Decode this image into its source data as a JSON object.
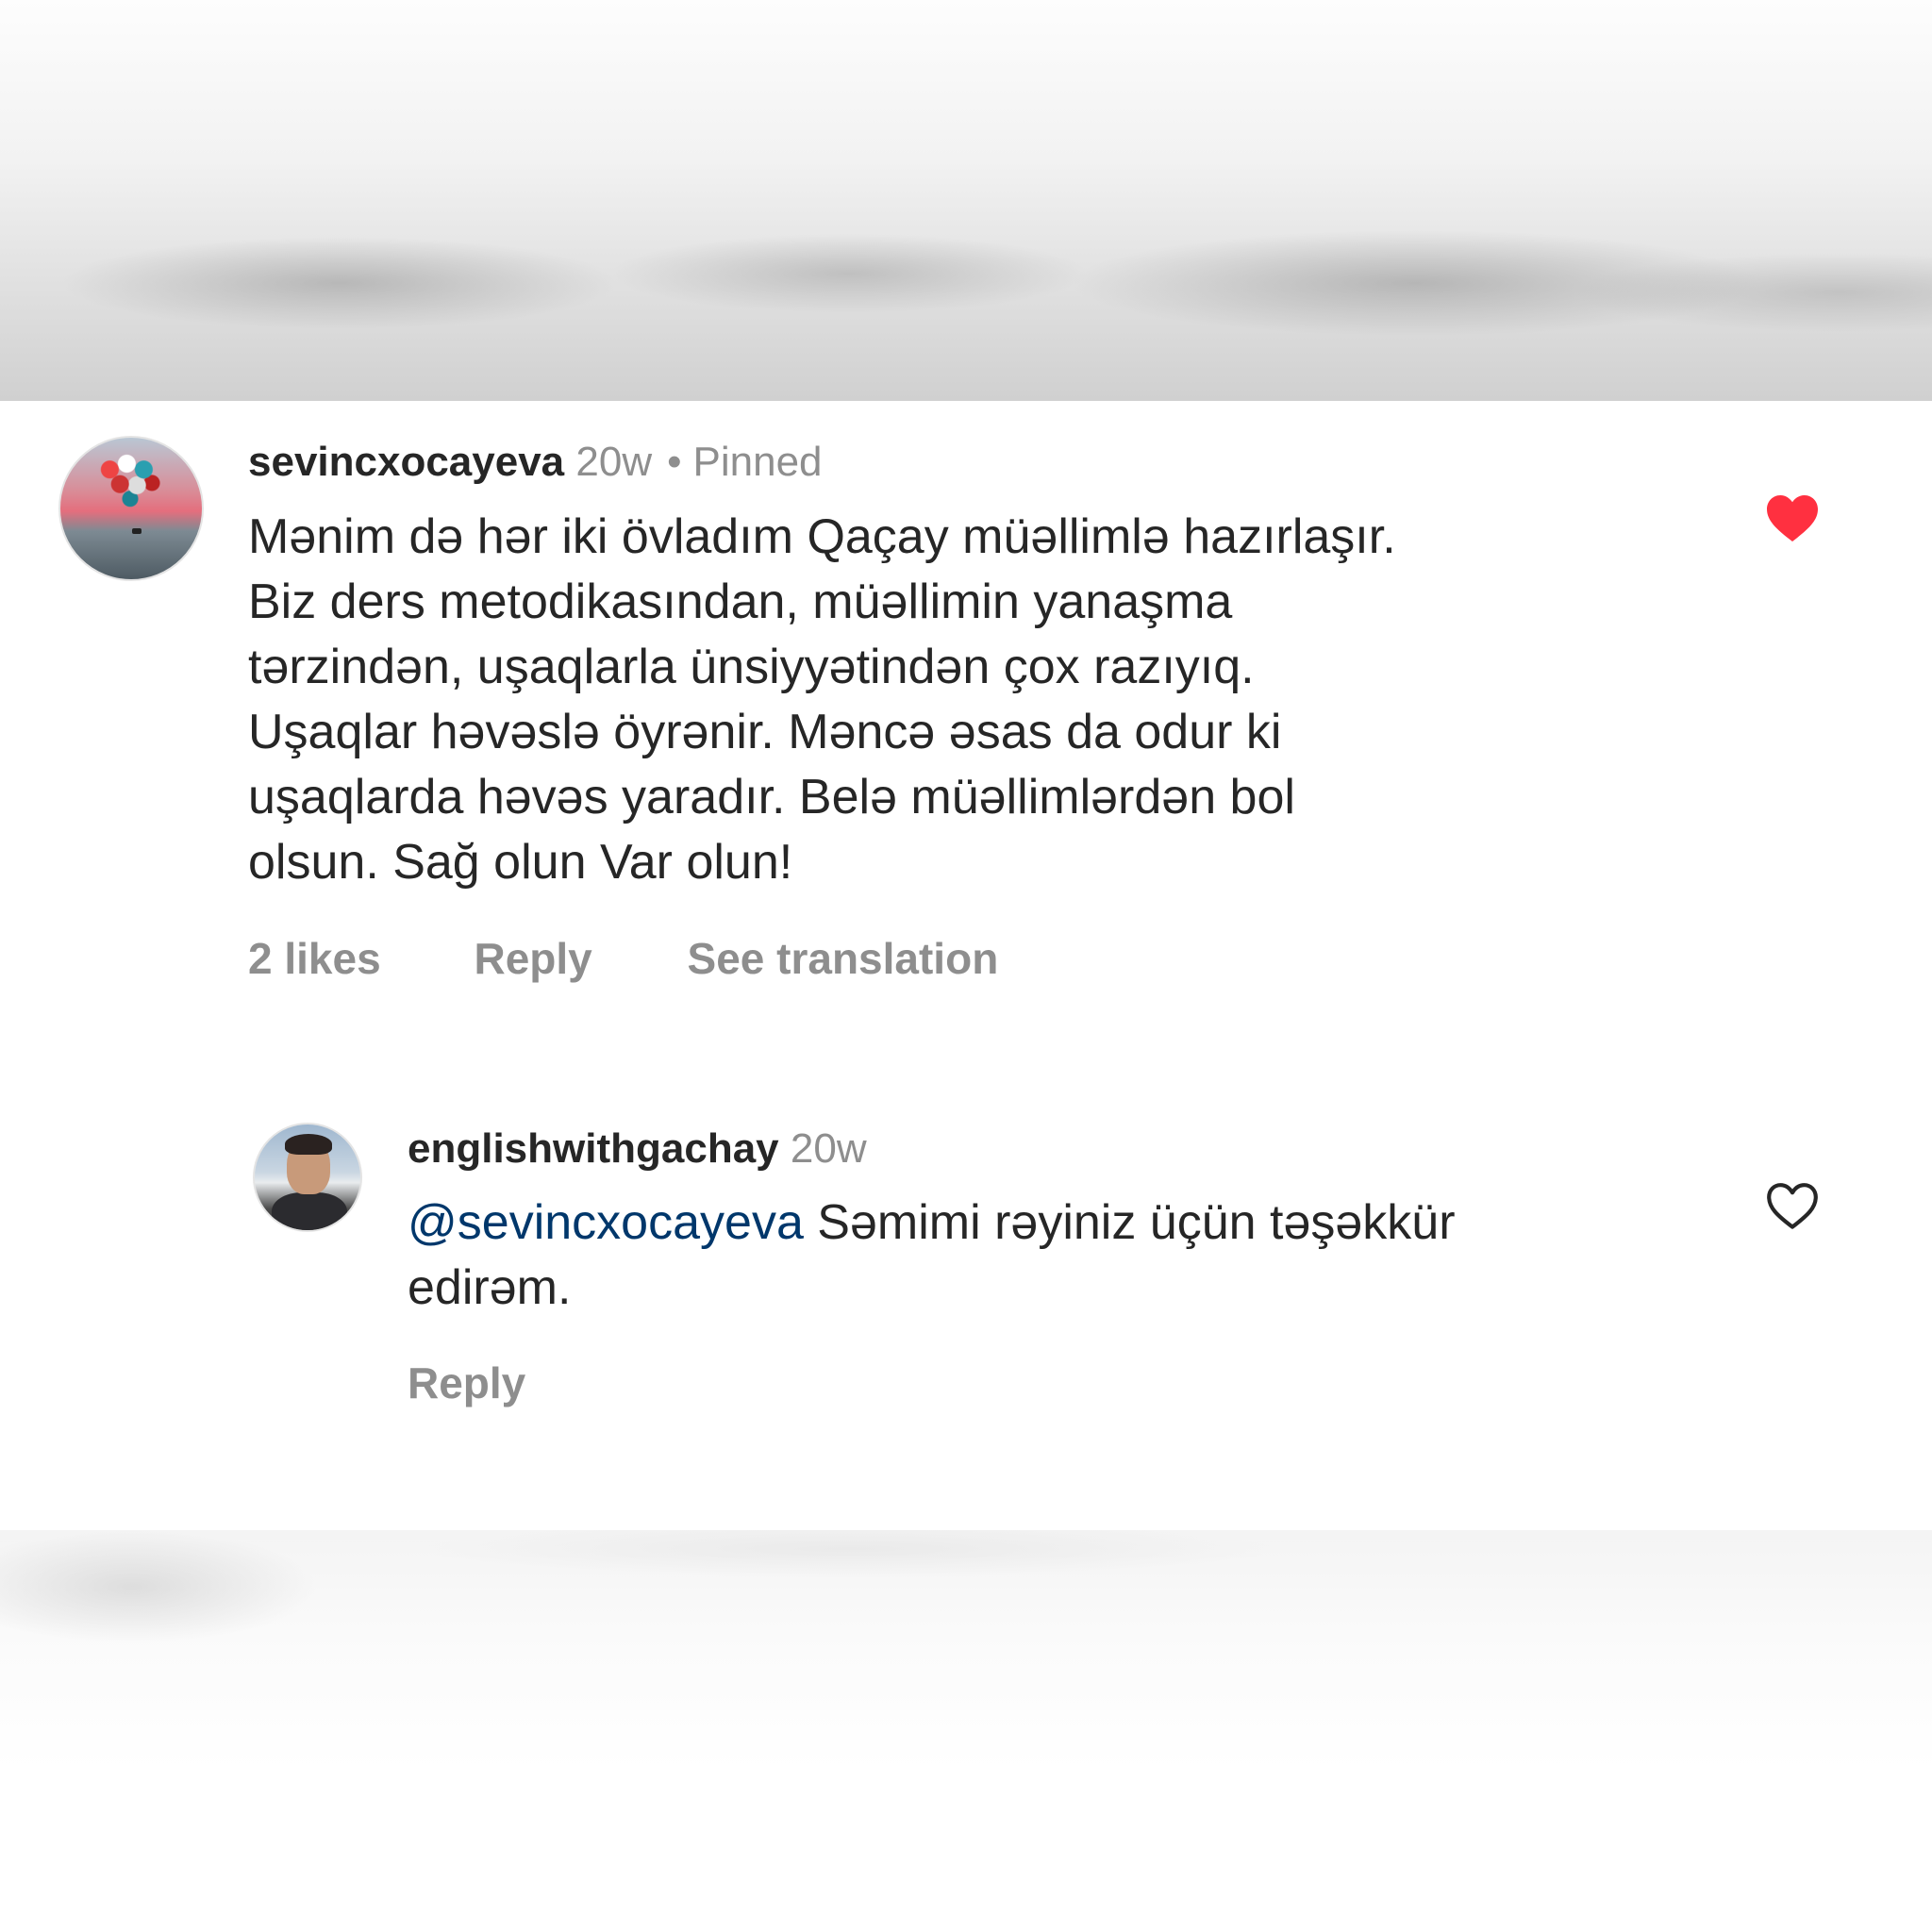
{
  "comments": [
    {
      "username": "sevincxocayeva",
      "time": "20w",
      "separator": "•",
      "pinned_label": "Pinned",
      "text_lines": [
        "Mənim də hər iki övladım Qaçay müəllimlə hazırlaşır.",
        "Biz ders metodikasından, müəllimin yanaşma",
        "tərzindən, uşaqlarla ünsiyyətindən çox razıyıq.",
        "Uşaqlar həvəslə öyrənir. Məncə əsas da odur ki",
        "uşaqlarda həvəs yaradır. Belə müəllimlərdən bol",
        "olsun. Sağ olun Var olun!"
      ],
      "likes": "2 likes",
      "reply_label": "Reply",
      "translation_label": "See translation",
      "liked": true,
      "like_icon": "heart-filled-icon",
      "like_color": "#ff3040"
    },
    {
      "username": "englishwithgachay",
      "time": "20w",
      "mention": "@sevincxocayeva",
      "text_after_mention": " Səmimi rəyiniz üçün təşəkkür",
      "text_line_2": "edirəm.",
      "reply_label": "Reply",
      "liked": false,
      "like_icon": "heart-outline-icon",
      "mention_color": "#00376b"
    }
  ],
  "colors": {
    "primary_text": "#262626",
    "secondary_text": "#8e8e8e",
    "background": "#ffffff"
  }
}
